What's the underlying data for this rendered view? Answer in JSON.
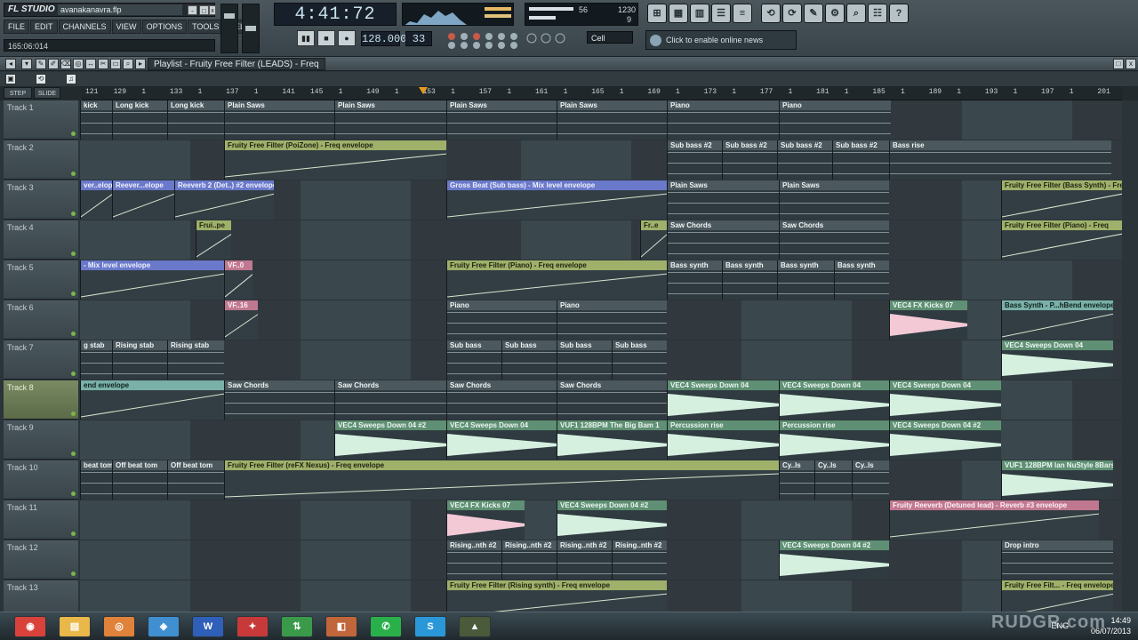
{
  "app": {
    "logo": "FL STUDIO",
    "project_file": "avanakanavra.flp",
    "window_buttons": [
      "-",
      "□",
      "x"
    ],
    "menu": [
      "FILE",
      "EDIT",
      "CHANNELS",
      "VIEW",
      "OPTIONS",
      "TOOLS",
      "HELP"
    ],
    "hint": "165:06:014"
  },
  "transport": {
    "time": "4:41:72",
    "tempo": "128.000",
    "pattern": "33",
    "snap": "Cell",
    "cpu_value": "56",
    "memory_value": "1230",
    "poly_value": "9",
    "online_text": "Click to enable online news",
    "buttons": [
      "▮▮",
      "■",
      "●"
    ]
  },
  "top_icons": [
    "⊞",
    "▦",
    "▥",
    "☰",
    "≡",
    "⟲",
    "⟳",
    "✎",
    "⚙",
    "⌕",
    "☷",
    "?"
  ],
  "playlist": {
    "title": "Playlist - Fruity Free Filter (LEADS) - Freq",
    "step_label": "STEP",
    "slide_label": "SLIDE",
    "ruler_ticks": [
      "121",
      "129",
      "1",
      "133",
      "1",
      "137",
      "1",
      "141",
      "145",
      "1",
      "149",
      "1",
      "153",
      "1",
      "157",
      "1",
      "161",
      "1",
      "165",
      "1",
      "169",
      "1",
      "173",
      "1",
      "177",
      "1",
      "181",
      "1",
      "185",
      "1",
      "189",
      "1",
      "193",
      "1",
      "197",
      "1",
      "201"
    ]
  },
  "tracks": [
    {
      "name": "Track 1"
    },
    {
      "name": "Track 2"
    },
    {
      "name": "Track 3"
    },
    {
      "name": "Track 4"
    },
    {
      "name": "Track 5"
    },
    {
      "name": "Track 6"
    },
    {
      "name": "Track 7"
    },
    {
      "name": "Track 8"
    },
    {
      "name": "Track 9"
    },
    {
      "name": "Track 10"
    },
    {
      "name": "Track 11"
    },
    {
      "name": "Track 12"
    },
    {
      "name": "Track 13"
    }
  ],
  "clips": {
    "t1": [
      "kick",
      "Long kick",
      "Long kick",
      "Plain Saws",
      "Plain Saws",
      "Plain Saws",
      "Plain Saws",
      "Piano",
      "Piano"
    ],
    "t2": [
      "Fruity Free Filter (PoiZone) - Freq envelope",
      "Sub bass #2",
      "Sub bass #2",
      "Sub bass #2",
      "Sub bass #2",
      "Bass rise"
    ],
    "t3": [
      "ver..elope",
      "Reever...elope",
      "Reeverb 2 (Det..) #2 envelope",
      "Gross Beat (Sub bass) - Mix level envelope",
      "Plain Saws",
      "Plain Saws",
      "Fruity Free Filter (Bass Synth) - Freq"
    ],
    "t4": [
      "Frui..pe",
      "Fr..e",
      "Saw Chords",
      "Saw Chords",
      "Fruity Free Filter (Piano) - Freq"
    ],
    "t5": [
      "- Mix level envelope",
      "VF..0",
      "Fruity Free Filter (Piano) - Freq envelope",
      "Bass synth",
      "Bass synth",
      "Bass synth",
      "Bass synth"
    ],
    "t6": [
      "VF..16",
      "Piano",
      "Piano",
      "VEC4 FX Kicks 07",
      "Bass Synth - P...hBend envelope"
    ],
    "t7": [
      "g stab",
      "Rising stab",
      "Rising stab",
      "Sub bass",
      "Sub bass",
      "Sub bass",
      "Sub bass",
      "VEC4 Sweeps Down 04"
    ],
    "t8": [
      "end envelope",
      "Saw Chords",
      "Saw Chords",
      "Saw Chords",
      "Saw Chords",
      "VEC4 Sweeps Down 04",
      "VEC4 Sweeps Down 04",
      "VEC4 Sweeps Down 04"
    ],
    "t9": [
      "VEC4 Sweeps Down 04 #2",
      "VEC4 Sweeps Down 04",
      "VUF1 128BPM The Big Bam 1",
      "Percussion rise",
      "Percussion rise",
      "VEC4 Sweeps Down 04 #2"
    ],
    "t10": [
      "beat tom",
      "Off beat tom",
      "Off beat tom",
      "Fruity Free Filter (reFX Nexus) - Freq envelope",
      "Cy..ls",
      "Cy..ls",
      "Cy..ls",
      "VUF1 128BPM Ian NuStyle 8Bars"
    ],
    "t11": [
      "VEC4 FX Kicks 07",
      "VEC4 Sweeps Down 04 #2",
      "Fruity Reeverb (Detuned lead) - Reverb #3 envelope"
    ],
    "t12": [
      "Rising..nth #2",
      "Rising..nth #2",
      "Rising..nth #2",
      "Rising..nth #2",
      "VEC4 Sweeps Down 04 #2",
      "Drop intro"
    ],
    "t13": [
      "Fruity Free Filter (Rising synth) - Freq envelope",
      "Fruity Free Filt... - Freq envelope"
    ]
  },
  "taskbar": {
    "icons": [
      "chrome",
      "folder",
      "firefox",
      "vlc",
      "word",
      "fl",
      "torrent",
      "explorer",
      "whatsapp",
      "skype",
      "fl-studio"
    ],
    "labels": [
      "◉",
      "▤",
      "◎",
      "◈",
      "W",
      "✦",
      "⇅",
      "◧",
      "✆",
      "S",
      "▲"
    ],
    "lang": "ENG",
    "time": "14:49",
    "date": "06/07/2013",
    "watermark": "RUDGR.com"
  },
  "colors": {
    "accent_auto": "#9fb06a",
    "auto_blue": "#6a79c9",
    "auto_pink": "#c07890",
    "audio_green": "#5f8f74",
    "playhead": "#e79a1f"
  }
}
